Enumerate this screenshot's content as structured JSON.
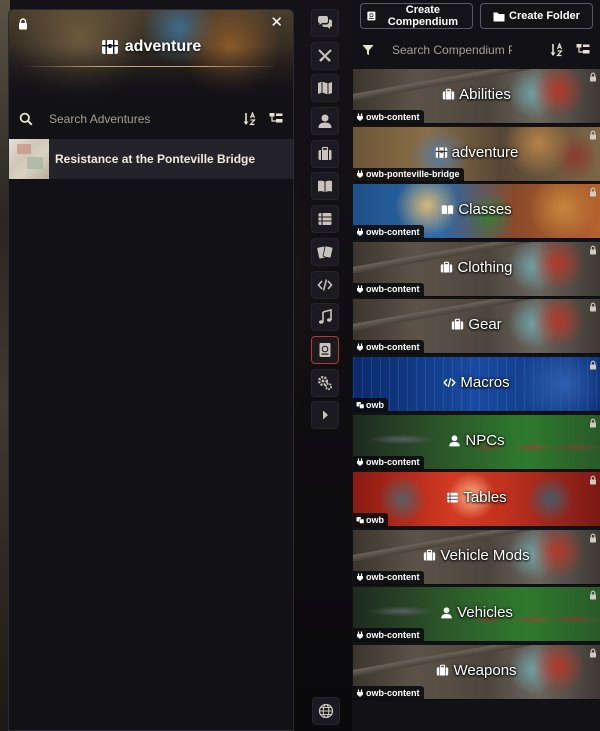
{
  "adventure_window": {
    "title": "adventure",
    "search_placeholder": "Search Adventures",
    "entries": [
      {
        "label": "Resistance at the Ponteville Bridge"
      }
    ]
  },
  "sidebar_tabs": [
    {
      "name": "chat-tab",
      "icon": "comments-icon"
    },
    {
      "name": "combat-tab",
      "icon": "crossed-swords-icon"
    },
    {
      "name": "scenes-tab",
      "icon": "map-icon"
    },
    {
      "name": "actors-tab",
      "icon": "user-icon"
    },
    {
      "name": "items-tab",
      "icon": "suitcase-icon"
    },
    {
      "name": "journal-tab",
      "icon": "book-open-icon"
    },
    {
      "name": "tables-tab",
      "icon": "table-list-icon"
    },
    {
      "name": "cards-tab",
      "icon": "cards-icon"
    },
    {
      "name": "macros-tab",
      "icon": "code-icon"
    },
    {
      "name": "playlists-tab",
      "icon": "music-icon"
    },
    {
      "name": "compendium-tab",
      "icon": "atlas-icon",
      "active": true
    },
    {
      "name": "settings-tab",
      "icon": "cogs-icon"
    },
    {
      "name": "collapse-tab",
      "icon": "caret-right-icon"
    }
  ],
  "compendium": {
    "create_compendium_label": "Create Compendium",
    "create_folder_label": "Create Folder",
    "search_placeholder": "Search Compendium Pa",
    "packs": [
      {
        "label": "Abilities",
        "source": "owb-content",
        "icon": "suitcase-icon",
        "theme": "gear",
        "source_icon": "plug-icon"
      },
      {
        "label": "adventure",
        "source": "owb-ponteville-bridge",
        "icon": "treasure-chest-icon",
        "theme": "adventure",
        "source_icon": "plug-icon"
      },
      {
        "label": "Classes",
        "source": "owb-content",
        "icon": "book-open-icon",
        "theme": "classes",
        "source_icon": "plug-icon"
      },
      {
        "label": "Clothing",
        "source": "owb-content",
        "icon": "suitcase-icon",
        "theme": "gear",
        "source_icon": "plug-icon"
      },
      {
        "label": "Gear",
        "source": "owb-content",
        "icon": "suitcase-icon",
        "theme": "gear",
        "source_icon": "plug-icon"
      },
      {
        "label": "Macros",
        "source": "owb",
        "icon": "code-icon",
        "theme": "macros",
        "source_icon": "dice-icon"
      },
      {
        "label": "NPCs",
        "source": "owb-content",
        "icon": "user-icon",
        "theme": "npcs",
        "source_icon": "plug-icon"
      },
      {
        "label": "Tables",
        "source": "owb",
        "icon": "table-list-icon",
        "theme": "tables",
        "source_icon": "dice-icon"
      },
      {
        "label": "Vehicle Mods",
        "source": "owb-content",
        "icon": "suitcase-icon",
        "theme": "gear",
        "source_icon": "plug-icon"
      },
      {
        "label": "Vehicles",
        "source": "owb-content",
        "icon": "user-icon",
        "theme": "vehicles",
        "source_icon": "plug-icon"
      },
      {
        "label": "Weapons",
        "source": "owb-content",
        "icon": "suitcase-icon",
        "theme": "gear",
        "source_icon": "plug-icon"
      }
    ]
  },
  "colors": {
    "panel_bg": "#121116",
    "active_tab_border": "#b83636",
    "row_bg": "#24232a"
  }
}
